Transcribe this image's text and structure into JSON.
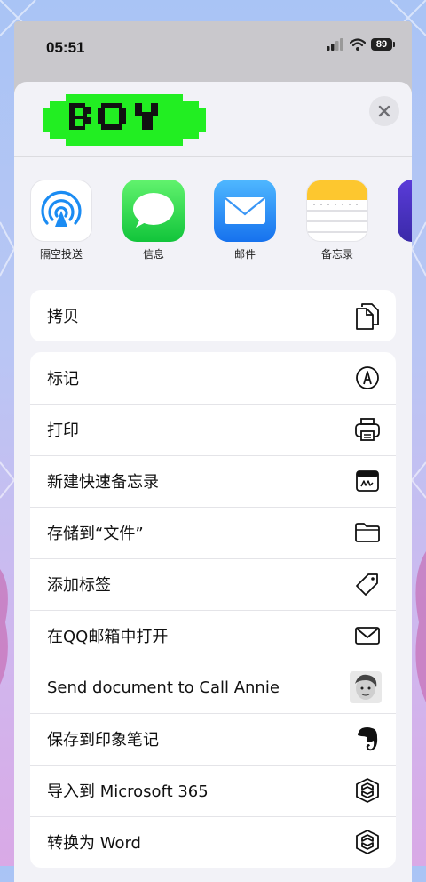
{
  "status": {
    "time": "05:51",
    "battery": "89"
  },
  "sheet": {
    "logo_text": "BOY",
    "apps": [
      {
        "label": "隔空投送",
        "icon": "airdrop-icon"
      },
      {
        "label": "信息",
        "icon": "messages-icon"
      },
      {
        "label": "邮件",
        "icon": "mail-icon"
      },
      {
        "label": "备忘录",
        "icon": "notes-icon"
      }
    ],
    "copy_label": "拷贝",
    "actions": [
      {
        "label": "标记",
        "icon": "markup-icon"
      },
      {
        "label": "打印",
        "icon": "printer-icon"
      },
      {
        "label": "新建快速备忘录",
        "icon": "quick-note-icon"
      },
      {
        "label": "存储到“文件”",
        "icon": "folder-icon"
      },
      {
        "label": "添加标签",
        "icon": "tag-icon"
      },
      {
        "label": "在QQ邮箱中打开",
        "icon": "envelope-icon"
      },
      {
        "label": "Send document to Call Annie",
        "icon": "call-annie-avatar-icon"
      },
      {
        "label": "保存到印象笔记",
        "icon": "evernote-icon"
      },
      {
        "label": "导入到 Microsoft 365",
        "icon": "microsoft-365-icon"
      },
      {
        "label": "转换为 Word",
        "icon": "microsoft-365-icon"
      }
    ]
  }
}
